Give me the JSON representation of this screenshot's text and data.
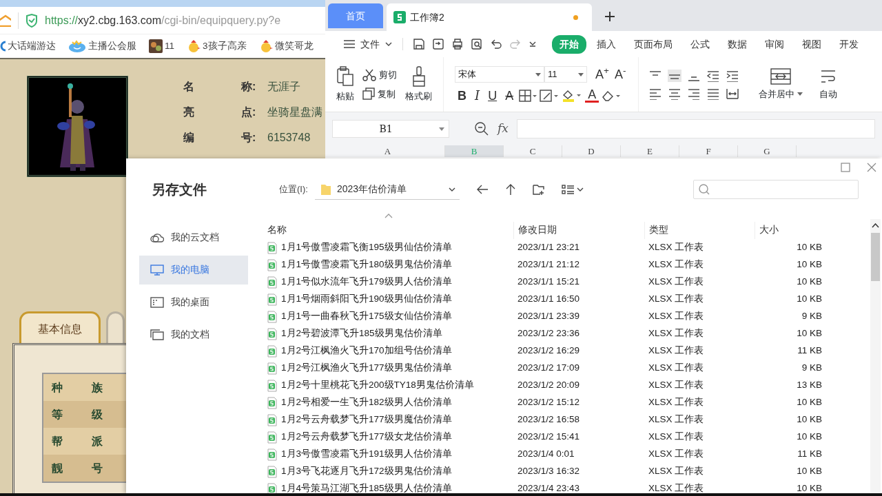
{
  "browser": {
    "url": {
      "scheme": "https://",
      "host": "xy2.cbg.163.com",
      "path": "/cgi-bin/equipquery.py?e"
    },
    "bookmarks": [
      {
        "kind": "swirl",
        "label": "大话端游达"
      },
      {
        "kind": "cloud",
        "label": "主播公会服"
      },
      {
        "kind": "tile",
        "label": "11"
      },
      {
        "kind": "chick",
        "label": "3孩子高亲"
      },
      {
        "kind": "chick",
        "label": "微笑哥龙"
      }
    ]
  },
  "role": {
    "portrait": {
      "kind": "picture"
    },
    "fields": [
      {
        "label": [
          "名",
          "称:"
        ],
        "value": "无涯子"
      },
      {
        "label": [
          "亮",
          "点:"
        ],
        "value": "坐骑星盘满"
      },
      {
        "label": [
          "编",
          "号:"
        ],
        "value": "6153748"
      }
    ],
    "tabs": [
      {
        "label": "基本信息",
        "selected": true
      },
      {
        "selected": false
      }
    ],
    "rows": [
      [
        "种",
        "族"
      ],
      [
        "等",
        "级"
      ],
      [
        "帮",
        "派"
      ],
      [
        "靓",
        "号"
      ]
    ]
  },
  "wps": {
    "tabs": [
      {
        "kind": "home",
        "label": "首页",
        "selected": false
      },
      {
        "kind": "doc",
        "label": "工作簿2",
        "selected": true,
        "modified": true
      }
    ],
    "file_menu": "文件",
    "menu": [
      {
        "label": "开始",
        "selected": true
      },
      {
        "label": "插入",
        "selected": false
      },
      {
        "label": "页面布局",
        "selected": false
      },
      {
        "label": "公式",
        "selected": false
      },
      {
        "label": "数据",
        "selected": false
      },
      {
        "label": "审阅",
        "selected": false
      },
      {
        "label": "视图",
        "selected": false
      },
      {
        "label": "开发",
        "selected": false
      }
    ],
    "ribbon": {
      "paste": "粘贴",
      "cut": "剪切",
      "copy": "复制",
      "format_painter": "格式刷",
      "font": "宋体",
      "size": "11",
      "grow": "A$^{+}$",
      "shrink": "A$^{-}$",
      "bold": "B",
      "italic": "I",
      "underline": "U",
      "strike": "A",
      "font_color": "A",
      "merge": "合并居中",
      "wrap": "自动"
    },
    "formula_bar": {
      "cell": "B1",
      "fx": "fx"
    },
    "columns": [
      {
        "label": "A",
        "selected": false
      },
      {
        "label": "B",
        "selected": true
      },
      {
        "label": "C",
        "selected": false
      },
      {
        "label": "D",
        "selected": false
      },
      {
        "label": "E",
        "selected": false
      },
      {
        "label": "F",
        "selected": false
      },
      {
        "label": "G",
        "selected": false
      }
    ]
  },
  "dialog": {
    "title": "另存文件",
    "location_label": "位置(I):",
    "location": "2023年估价清单",
    "places": [
      {
        "kind": "cloud",
        "label": "我的云文档",
        "selected": false
      },
      {
        "kind": "computer",
        "label": "我的电脑",
        "selected": true
      },
      {
        "kind": "desktop",
        "label": "我的桌面",
        "selected": false
      },
      {
        "kind": "docs",
        "label": "我的文档",
        "selected": false
      }
    ],
    "columns": [
      "名称",
      "修改日期",
      "类型",
      "大小"
    ],
    "files": [
      {
        "name": "1月1号傲雪凌霜飞衡195级男仙估价清单",
        "modified": "2023/1/1 23:21",
        "type": "XLSX 工作表",
        "size": "10 KB"
      },
      {
        "name": "1月1号傲雪凌霜飞升180级男鬼估价清单",
        "modified": "2023/1/1 21:12",
        "type": "XLSX 工作表",
        "size": "10 KB"
      },
      {
        "name": "1月1号似水流年飞升179级男人估价清单",
        "modified": "2023/1/1 15:21",
        "type": "XLSX 工作表",
        "size": "10 KB"
      },
      {
        "name": "1月1号烟雨斜阳飞升190级男仙估价清单",
        "modified": "2023/1/1 16:50",
        "type": "XLSX 工作表",
        "size": "10 KB"
      },
      {
        "name": "1月1号一曲春秋飞升175级女仙估价清单",
        "modified": "2023/1/1 23:39",
        "type": "XLSX 工作表",
        "size": "9 KB"
      },
      {
        "name": "1月2号碧波潭飞升185级男鬼估价清单",
        "modified": "2023/1/2 23:36",
        "type": "XLSX 工作表",
        "size": "10 KB"
      },
      {
        "name": "1月2号江枫渔火飞升170加组号估价清单",
        "modified": "2023/1/2 16:29",
        "type": "XLSX 工作表",
        "size": "11 KB"
      },
      {
        "name": "1月2号江枫渔火飞升177级男鬼估价清单",
        "modified": "2023/1/2 17:09",
        "type": "XLSX 工作表",
        "size": "9 KB"
      },
      {
        "name": "1月2号十里桃花飞升200级TY18男鬼估价清单",
        "modified": "2023/1/2 20:09",
        "type": "XLSX 工作表",
        "size": "13 KB"
      },
      {
        "name": "1月2号相爱一生飞升182级男人估价清单",
        "modified": "2023/1/2 15:12",
        "type": "XLSX 工作表",
        "size": "10 KB"
      },
      {
        "name": "1月2号云舟载梦飞升177级男魔估价清单",
        "modified": "2023/1/2 16:58",
        "type": "XLSX 工作表",
        "size": "10 KB"
      },
      {
        "name": "1月2号云舟载梦飞升177级女龙估价清单",
        "modified": "2023/1/2 15:41",
        "type": "XLSX 工作表",
        "size": "10 KB"
      },
      {
        "name": "1月3号傲雪凌霜飞升191级男人估价清单",
        "modified": "2023/1/4 0:01",
        "type": "XLSX 工作表",
        "size": "11 KB"
      },
      {
        "name": "1月3号飞花逐月飞升172级男鬼估价清单",
        "modified": "2023/1/3 16:32",
        "type": "XLSX 工作表",
        "size": "10 KB"
      },
      {
        "name": "1月4号策马江湖飞升185级男人估价清单",
        "modified": "2023/1/4 23:43",
        "type": "XLSX 工作表",
        "size": "10 KB"
      }
    ]
  }
}
